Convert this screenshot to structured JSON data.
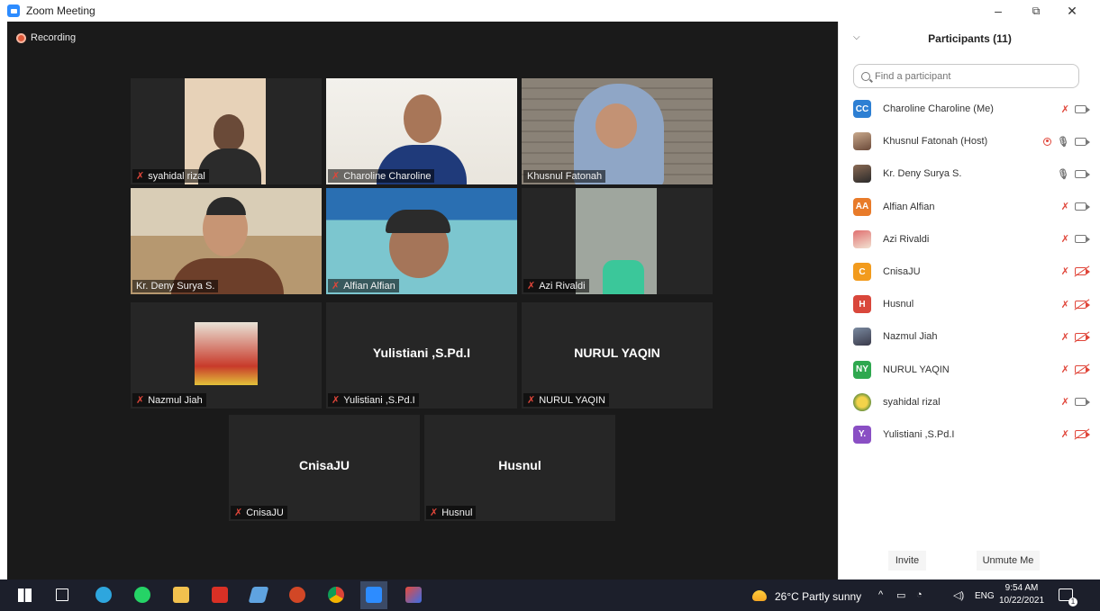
{
  "window": {
    "title": "Zoom Meeting",
    "minimize": "–",
    "restore": "⧉",
    "close": "✕"
  },
  "recording_label": "Recording",
  "tiles": [
    {
      "name": "syahidal rizal",
      "muted": true
    },
    {
      "name": "Charoline Charoline",
      "muted": true
    },
    {
      "name": "Khusnul Fatonah",
      "muted": false
    },
    {
      "name": "Kr. Deny Surya S.",
      "muted": false,
      "active": true
    },
    {
      "name": "Alfian Alfian",
      "muted": true
    },
    {
      "name": "Azi Rivaldi",
      "muted": true
    },
    {
      "name": "Nazmul Jiah",
      "muted": true
    },
    {
      "name": "Yulistiani ,S.Pd.I",
      "muted": true,
      "display_name": "Yulistiani ,S.Pd.I"
    },
    {
      "name": "NURUL YAQIN",
      "muted": true,
      "display_name": "NURUL YAQIN"
    },
    {
      "name": "CnisaJU",
      "muted": true,
      "display_name": "CnisaJU"
    },
    {
      "name": "Husnul",
      "muted": true,
      "display_name": "Husnul"
    }
  ],
  "panel": {
    "collapse_icon": "chevron-down-icon",
    "title": "Participants (11)",
    "search_placeholder": "Find a participant",
    "participants": [
      {
        "initials": "CC",
        "color": "#2d7fd3",
        "name": "Charoline Charoline (Me)",
        "mic": "muted",
        "cam": "on"
      },
      {
        "initials": "",
        "color": "",
        "name": "Khusnul Fatonah (Host)",
        "mic": "on",
        "cam": "on",
        "recording": true
      },
      {
        "initials": "",
        "color": "",
        "name": "Kr. Deny Surya S.",
        "mic": "on",
        "cam": "on"
      },
      {
        "initials": "AA",
        "color": "#e87b2a",
        "name": "Alfian Alfian",
        "mic": "muted",
        "cam": "on"
      },
      {
        "initials": "",
        "color": "",
        "name": "Azi Rivaldi",
        "mic": "muted",
        "cam": "on"
      },
      {
        "initials": "C",
        "color": "#f29b1d",
        "name": "CnisaJU",
        "mic": "muted",
        "cam": "off"
      },
      {
        "initials": "H",
        "color": "#d9473b",
        "name": "Husnul",
        "mic": "muted",
        "cam": "off"
      },
      {
        "initials": "",
        "color": "",
        "name": "Nazmul Jiah",
        "mic": "muted",
        "cam": "off"
      },
      {
        "initials": "NY",
        "color": "#2fa84f",
        "name": "NURUL YAQIN",
        "mic": "muted",
        "cam": "off"
      },
      {
        "initials": "",
        "color": "",
        "name": "syahidal rizal",
        "mic": "muted",
        "cam": "on"
      },
      {
        "initials": "Y.",
        "color": "#8a4fc4",
        "name": "Yulistiani ,S.Pd.I",
        "mic": "muted",
        "cam": "off"
      }
    ],
    "invite_label": "Invite",
    "unmute_label": "Unmute Me"
  },
  "taskbar": {
    "weather": "26°C  Partly sunny",
    "lang": "ENG",
    "time": "9:54 AM",
    "date": "10/22/2021",
    "notifications": "1",
    "apps": [
      "start-icon",
      "task-view-icon",
      "telegram-icon",
      "whatsapp-icon",
      "file-explorer-icon",
      "acrobat-icon",
      "notes-icon",
      "powerpoint-icon",
      "chrome-icon",
      "zoom-icon",
      "paint-icon"
    ]
  }
}
